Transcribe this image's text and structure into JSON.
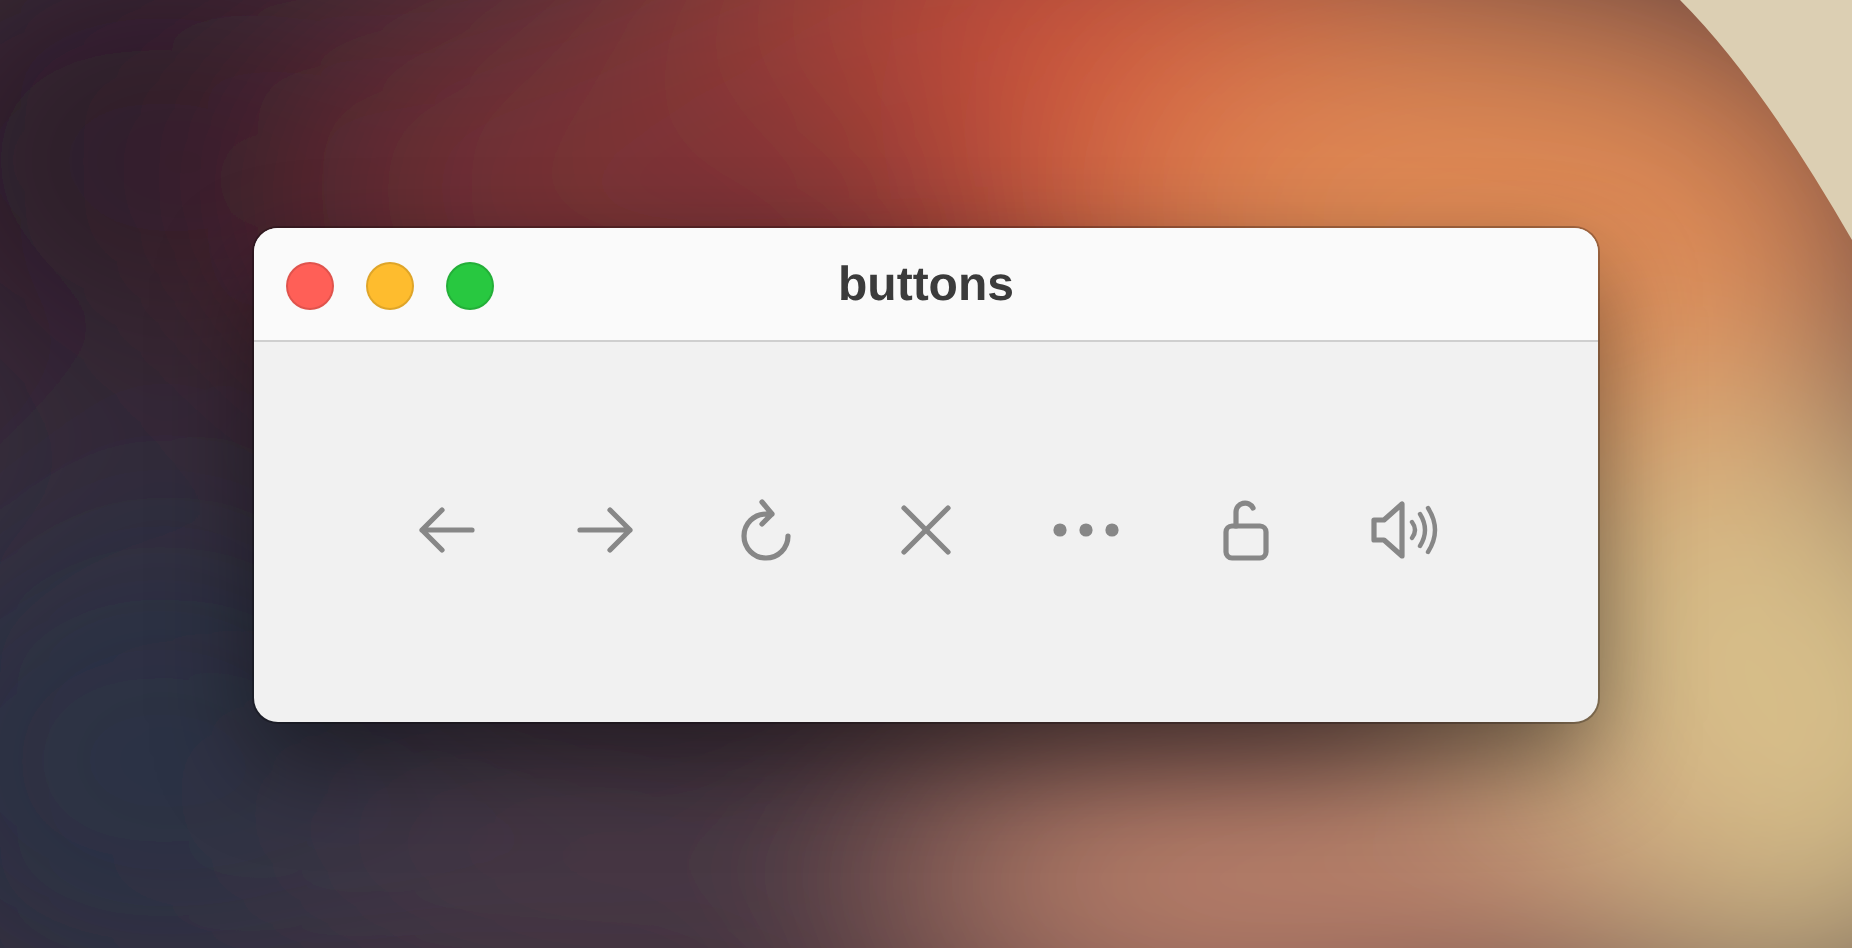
{
  "window": {
    "title": "buttons",
    "controls": [
      {
        "color": "#ff5f57"
      },
      {
        "color": "#febc2e"
      },
      {
        "color": "#28c840"
      }
    ]
  },
  "buttons": [
    {
      "kind": "back"
    },
    {
      "kind": "forward"
    },
    {
      "kind": "reload"
    },
    {
      "kind": "close"
    },
    {
      "kind": "more"
    },
    {
      "kind": "unlock"
    },
    {
      "kind": "volume"
    }
  ]
}
